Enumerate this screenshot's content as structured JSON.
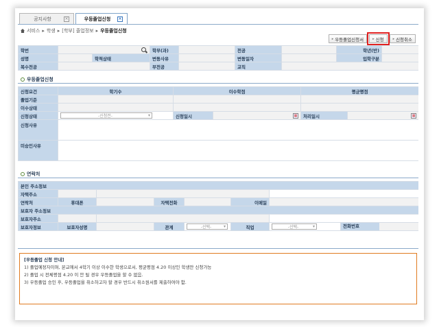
{
  "tabs": [
    {
      "label": "공지사항"
    },
    {
      "label": "우등졸업신청"
    }
  ],
  "breadcrumb": {
    "items": [
      "서비스",
      "학생",
      "[학부] 졸업정보"
    ],
    "current": "우등졸업신청"
  },
  "buttons": {
    "apply_form": "우등졸업신청서",
    "apply": "신청",
    "cancel": "신청취소"
  },
  "student_info": {
    "student_no": "학번",
    "dept": "학부(과)",
    "major": "전공",
    "grade": "학년(반)",
    "name": "성명",
    "status": "학적상태",
    "change_reason": "변동사유",
    "change_date": "변동일자",
    "admission_type": "입학구분",
    "double_major": "복수전공",
    "minor": "부전공",
    "cert": "교직"
  },
  "section_apply": {
    "title": "우등졸업신청"
  },
  "apply_table": {
    "col_req": "신청요건",
    "col_credits": "학기수",
    "col_earned": "이수학점",
    "col_gpa": "평균평점",
    "row_criteria": "졸업기준",
    "row_status": "이수상태",
    "apply_status": "신청상태",
    "apply_status_select": "-신청전-",
    "apply_date": "신청일시",
    "process_date": "처리일시",
    "apply_reason": "신청사유",
    "reject_reason": "미승인사유"
  },
  "section_contact": {
    "title": "연락처"
  },
  "contact": {
    "self_addr_info": "본인 주소정보",
    "home_addr": "자택주소",
    "contact": "연락처",
    "mobile": "휴대폰",
    "home_phone": "자택전화",
    "email": "이메일",
    "guardian_addr_info": "보호자 주소정보",
    "guardian_addr": "보호자주소",
    "guardian_info": "보호자정보",
    "guardian_name": "보호자성명",
    "relation": "관계",
    "relation_select": "-선택-",
    "job": "직업",
    "job_select": "-선택-",
    "phone": "전화번호"
  },
  "guide": {
    "title": "[우등졸업 신청 안내]",
    "line1": "1) 졸업예정자이며, 본교에서 4학기 이상 이수한 학생으로서, 평균평점 4.20  이상인 학생만 신청가능",
    "line2": "2) 졸업 시 전체평점 4.20  이 안 될 경우 우등졸업을 할 수 없음.",
    "line3": "3) 우등졸업 승인 후, 우등졸업을 취소하고자 할 경우 반드시 취소원서를 제출하여야 함."
  },
  "colors": {
    "label_bg": "#c5d7ea",
    "highlight": "#e02020",
    "guide_border": "#e07a1e"
  }
}
